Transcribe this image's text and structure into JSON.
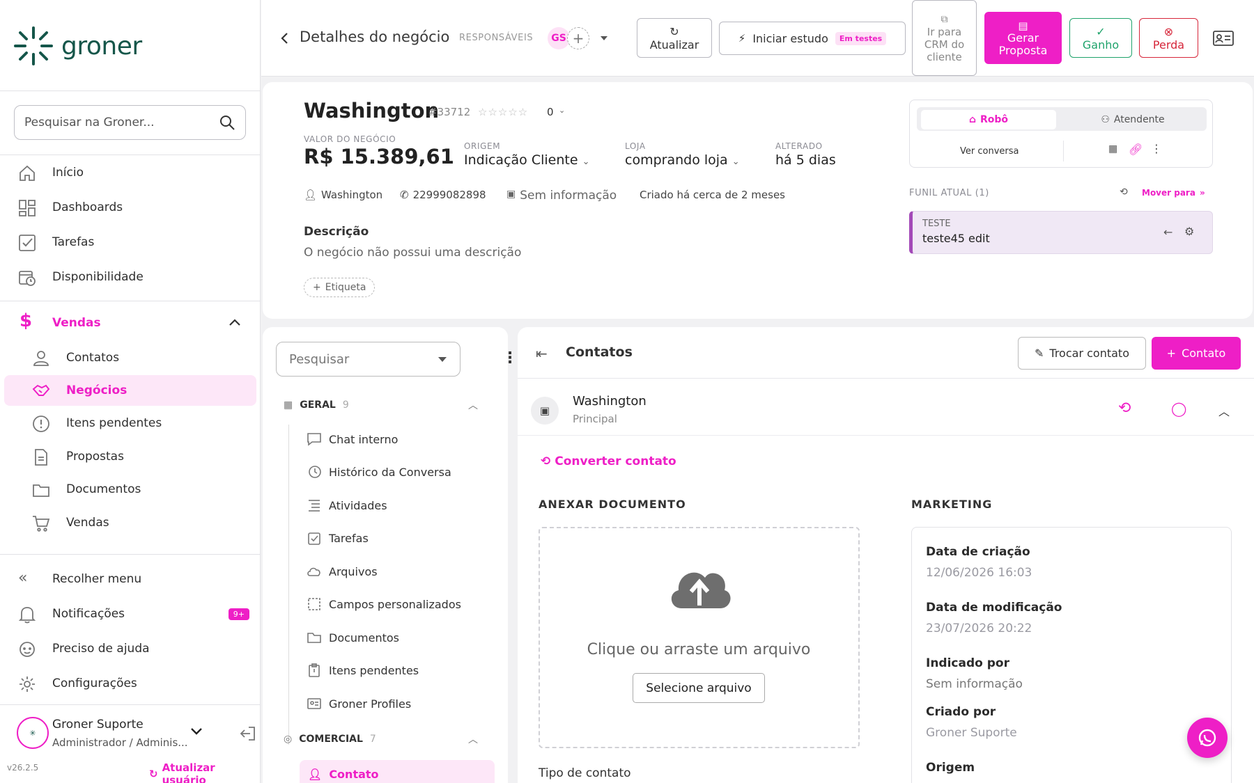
{
  "brand": {
    "name": "groner",
    "version": "v26.2.5"
  },
  "sidebar": {
    "search_placeholder": "Pesquisar na Groner...",
    "items": [
      {
        "label": "Início"
      },
      {
        "label": "Dashboards"
      },
      {
        "label": "Tarefas"
      },
      {
        "label": "Disponibilidade"
      }
    ],
    "section": {
      "label": "Vendas"
    },
    "sub_items": [
      {
        "label": "Contatos"
      },
      {
        "label": "Negócios"
      },
      {
        "label": "Itens pendentes"
      },
      {
        "label": "Propostas"
      },
      {
        "label": "Documentos"
      },
      {
        "label": "Vendas"
      }
    ],
    "bottom": [
      {
        "label": "Recolher menu"
      },
      {
        "label": "Notificações",
        "badge": "9+"
      },
      {
        "label": "Preciso de ajuda"
      },
      {
        "label": "Configurações"
      }
    ],
    "user": {
      "name": "Groner Suporte",
      "role": "Administrador / Adminis...",
      "update": "Atualizar usuário"
    }
  },
  "header": {
    "title": "Detalhes do negócio",
    "responsaveis": "RESPONSÁVEIS",
    "avatar": "GS",
    "buttons": {
      "atualizar": "Atualizar",
      "iniciar": "Iniciar estudo",
      "em_testes": "Em testes",
      "crm": "Ir para CRM do cliente",
      "gerar": "Gerar Proposta",
      "ganho": "Ganho",
      "perda": "Perda"
    }
  },
  "deal": {
    "name": "Washington",
    "id": "#33712",
    "rating": "0",
    "value_label": "VALOR DO NEGÓCIO",
    "value": "R$ 15.389,61",
    "origem_label": "ORIGEM",
    "origem": "Indicação Cliente",
    "loja_label": "LOJA",
    "loja": "comprando loja",
    "alterado_label": "ALTERADO",
    "alterado": "há 5 dias",
    "contact": "Washington",
    "phone": "22999082898",
    "sem_info": "Sem informação",
    "criado": "Criado há cerca de 2 meses",
    "desc_title": "Descrição",
    "desc": "O negócio não possui uma descrição",
    "tag": "Etiqueta"
  },
  "assistant": {
    "tab_robo": "Robô",
    "tab_atendente": "Atendente",
    "ver_conversa": "Ver conversa",
    "funil_label": "FUNIL ATUAL (1)",
    "mover": "Mover para",
    "stage_group": "TESTE",
    "stage": "teste45 edit"
  },
  "left_panel": {
    "search": "Pesquisar",
    "group1": {
      "label": "GERAL",
      "count": "9"
    },
    "items": [
      "Chat interno",
      "Histórico da Conversa",
      "Atividades",
      "Tarefas",
      "Arquivos",
      "Campos personalizados",
      "Documentos",
      "Itens pendentes",
      "Groner Profiles"
    ],
    "group2": {
      "label": "COMERCIAL",
      "count": "7"
    },
    "active": "Contato"
  },
  "contacts": {
    "title": "Contatos",
    "trocar": "Trocar contato",
    "add": "Contato",
    "name": "Washington",
    "role": "Principal",
    "converter": "Converter contato",
    "anexar": "ANEXAR DOCUMENTO",
    "upload_text": "Clique ou arraste um arquivo",
    "upload_btn": "Selecione arquivo",
    "tipo": "Tipo de contato",
    "marketing": "MARKETING",
    "fields": [
      {
        "label": "Data de criação",
        "value": "12/06/2026 16:03"
      },
      {
        "label": "Data de modificação",
        "value": "23/07/2026 20:22"
      },
      {
        "label": "Indicado por",
        "value": "Sem informação"
      },
      {
        "label": "Criado por",
        "value": "Groner Suporte"
      },
      {
        "label": "Origem",
        "value": ""
      }
    ]
  },
  "colors": {
    "accent": "#ee1fc6",
    "brand": "#15564a",
    "success": "#1fa36b",
    "danger": "#d6263a"
  }
}
